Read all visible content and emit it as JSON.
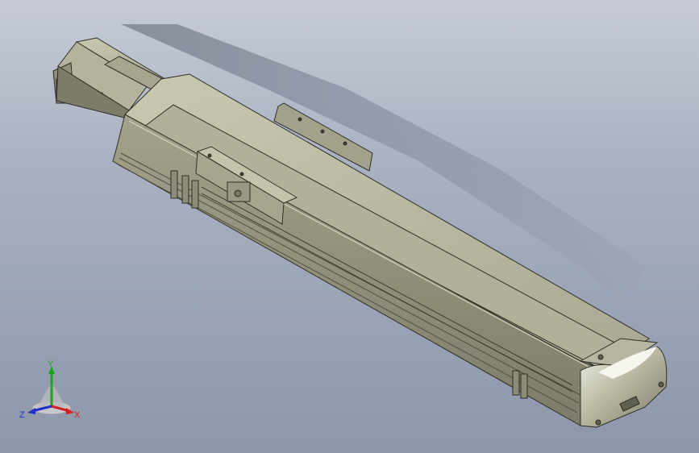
{
  "view": {
    "model_description_icon": "linear-actuator-3d-model",
    "colors": {
      "background_top": "#c6cbd6",
      "background_bottom": "#8e97aa",
      "body_light": "#bfbfa8",
      "body_mid": "#9c9c86",
      "body_dark": "#6f6f5e",
      "edge": "#2e2e27"
    }
  },
  "triad": {
    "x_label": "X",
    "y_label": "Y",
    "z_label": "Z",
    "x_color": "#d42020",
    "y_color": "#1fa01f",
    "z_color": "#2030c8"
  }
}
